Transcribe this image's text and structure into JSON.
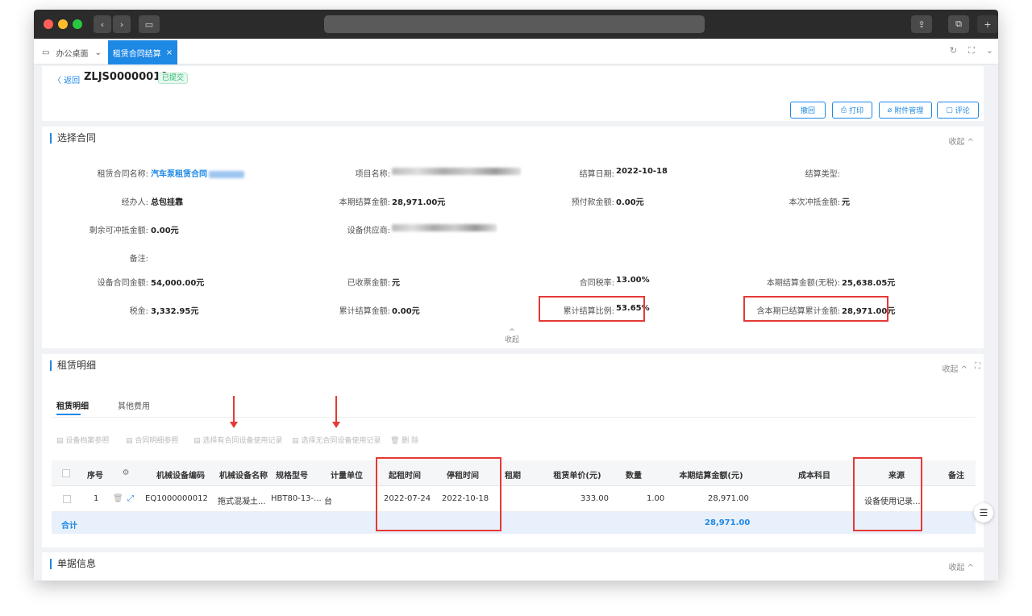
{
  "header": {
    "back": "〈 返回",
    "code": "ZLJS00000010",
    "badge": "已提交",
    "buttons": [
      "撤回",
      "打印",
      "附件管理",
      "评论"
    ]
  },
  "tabs": {
    "home": "办公桌面",
    "active": "租赁合同结算"
  },
  "contract": {
    "title": "选择合同",
    "collapse": "收起 ^",
    "fields": {
      "contract_name_label": "租赁合同名称:",
      "contract_name_value": "汽车泵租赁合同",
      "project_label": "项目名称:",
      "settle_date_label": "结算日期:",
      "settle_date_value": "2022-10-18",
      "settle_type_label": "结算类型:",
      "handler_label": "经办人:",
      "handler_value": "总包挂靠",
      "period_amount_label": "本期结算金额:",
      "period_amount_value": "28,971.00元",
      "prepay_label": "预付款金额:",
      "prepay_value": "0.00元",
      "offset_label": "本次冲抵金额:",
      "offset_value": "元",
      "remain_label": "剩余可冲抵金额:",
      "remain_value": "0.00元",
      "supplier_label": "设备供应商:",
      "remark_label": "备注:",
      "contract_amount_label": "设备合同金额:",
      "contract_amount_value": "54,000.00元",
      "invoice_label": "已收票金额:",
      "invoice_value": "元",
      "tax_rate_label": "合同税率:",
      "tax_rate_value": "13.00%",
      "no_tax_label": "本期结算金额(无税):",
      "no_tax_value": "25,638.05元",
      "tax_label": "税金:",
      "tax_value": "3,332.95元",
      "cum_amount_label": "累计结算金额:",
      "cum_amount_value": "0.00元",
      "cum_ratio_label": "累计结算比例:",
      "cum_ratio_value": "53.65%",
      "incl_cum_label": "含本期已结算累计金额:",
      "incl_cum_value": "28,971.00元"
    },
    "collapse_center": "收起"
  },
  "detail": {
    "title": "租赁明细",
    "collapse": "收起 ^",
    "subtabs": [
      "租赁明细",
      "其他费用"
    ],
    "tools": [
      "设备档案参照",
      "合同明细参照",
      "选择有合同设备使用记录",
      "选择无合同设备使用记录",
      "删 除"
    ],
    "columns": [
      "序号",
      "机械设备编码",
      "机械设备名称",
      "规格型号",
      "计量单位",
      "起租时间",
      "停租时间",
      "租期",
      "租赁单价(元)",
      "数量",
      "本期结算金额(元)",
      "成本科目",
      "来源",
      "备注"
    ],
    "row": {
      "no": "1",
      "code": "EQ1000000012",
      "name": "拖式混凝土...",
      "spec": "HBT80-13-...",
      "unit": "台",
      "start": "2022-07-24",
      "stop": "2022-10-18",
      "price": "333.00",
      "qty": "1.00",
      "amount": "28,971.00",
      "source": "设备使用记录..."
    },
    "total_label": "合计",
    "total_value": "28,971.00"
  },
  "doc": {
    "title": "单据信息",
    "collapse": "收起 ^"
  }
}
